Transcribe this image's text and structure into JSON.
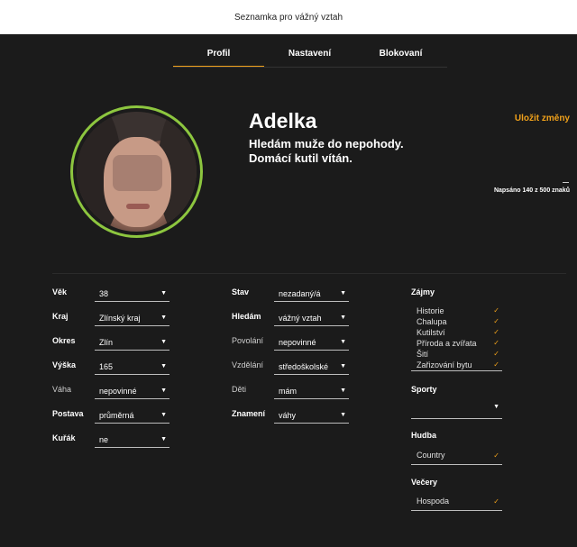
{
  "header": {
    "title": "Seznamka pro vážný vztah"
  },
  "tabs": [
    {
      "label": "Profil",
      "active": true
    },
    {
      "label": "Nastavení",
      "active": false
    },
    {
      "label": "Blokovaní",
      "active": false
    }
  ],
  "profile": {
    "name": "Adelka",
    "bio_line1": "Hledám muže do nepohody.",
    "bio_line2": "Domácí kutil vítán.",
    "save_label": "Uložit změny",
    "counter": "Napsáno 140 z 500 znaků"
  },
  "col1": [
    {
      "label": "Věk",
      "value": "38"
    },
    {
      "label": "Kraj",
      "value": "Zlínský kraj"
    },
    {
      "label": "Okres",
      "value": "Zlín"
    },
    {
      "label": "Výška",
      "value": "165"
    },
    {
      "label": "Váha",
      "value": "nepovinné"
    },
    {
      "label": "Postava",
      "value": "průměrná"
    },
    {
      "label": "Kuřák",
      "value": "ne"
    }
  ],
  "col2": [
    {
      "label": "Stav",
      "value": "nezadaný/á"
    },
    {
      "label": "Hledám",
      "value": "vážný vztah"
    },
    {
      "label": "Povolání",
      "value": "nepovinné"
    },
    {
      "label": "Vzdělání",
      "value": "středoškolské"
    },
    {
      "label": "Děti",
      "value": "mám"
    },
    {
      "label": "Znamení",
      "value": "váhy"
    }
  ],
  "interests": {
    "label": "Zájmy",
    "items": [
      "Historie",
      "Chalupa",
      "Kutilství",
      "Příroda a zvířata",
      "Šití",
      "Zařizování bytu"
    ]
  },
  "sports": {
    "label": "Sporty",
    "value": ""
  },
  "music": {
    "label": "Hudba",
    "value": "Country"
  },
  "evenings": {
    "label": "Večery",
    "value": "Hospoda"
  },
  "icons": {
    "check": "check-icon",
    "arrow": "caret-down-icon"
  },
  "colors": {
    "accent": "#f0a11b",
    "ring": "#8dc63f",
    "background": "#1b1b1b"
  }
}
